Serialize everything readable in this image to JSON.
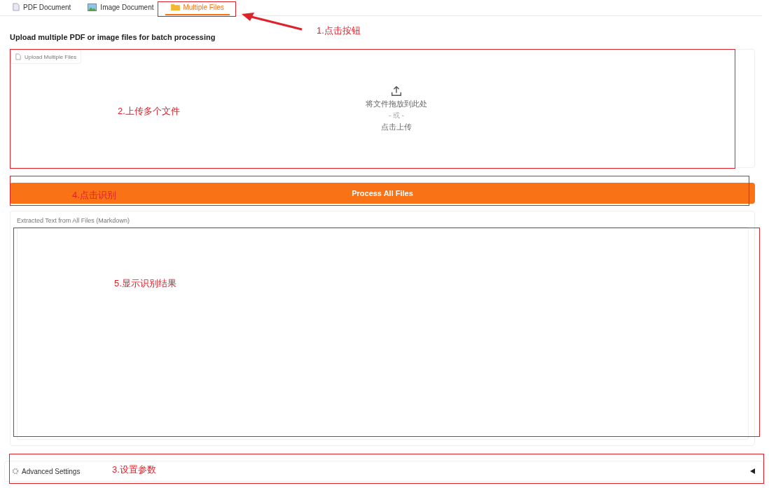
{
  "tabs": [
    {
      "label": "PDF Document",
      "kind": "document",
      "selected": false
    },
    {
      "label": "Image Document",
      "kind": "image",
      "selected": false
    },
    {
      "label": "Multiple Files",
      "kind": "folder",
      "selected": true
    }
  ],
  "heading": "Upload multiple PDF or image files for batch processing",
  "upload": {
    "label": "Upload Multiple Files",
    "drop_text": "将文件拖放到此处",
    "or_text": "- 或 -",
    "click_text": "点击上传"
  },
  "process_button": "Process All Files",
  "output": {
    "label": "Extracted Text from All Files (Markdown)"
  },
  "advanced": {
    "label": "Advanced Settings",
    "expanded": false
  },
  "annotations": [
    {
      "text": "1.点击按钮"
    },
    {
      "text": "2.上传多个文件"
    },
    {
      "text": "4.点击识别"
    },
    {
      "text": "5.显示识别结果"
    },
    {
      "text": "3.设置参数"
    }
  ]
}
